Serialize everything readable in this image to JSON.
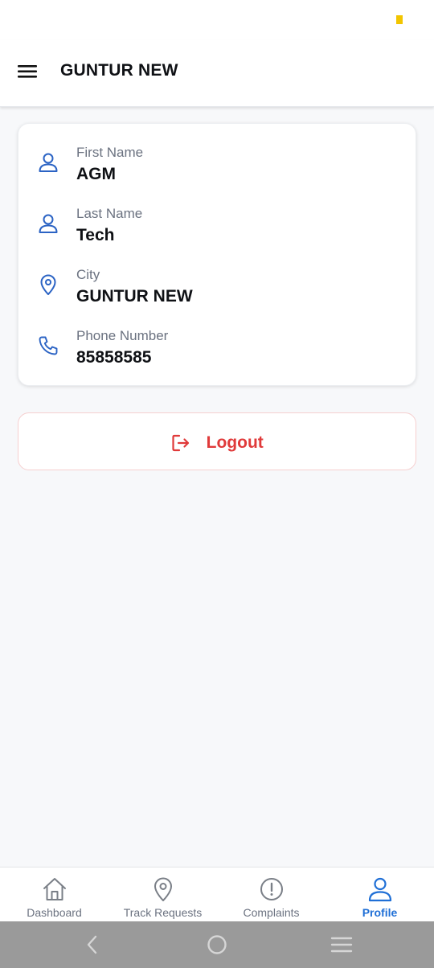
{
  "header": {
    "title": "GUNTUR NEW",
    "menu_icon": "hamburger-menu-icon"
  },
  "profile": {
    "fields": [
      {
        "label": "First Name",
        "value": "AGM",
        "icon": "user-icon"
      },
      {
        "label": "Last Name",
        "value": "Tech",
        "icon": "user-icon"
      },
      {
        "label": "City",
        "value": "GUNTUR NEW",
        "icon": "location-pin-icon"
      },
      {
        "label": "Phone Number",
        "value": "85858585",
        "icon": "phone-icon"
      }
    ]
  },
  "logout": {
    "label": "Logout",
    "icon": "logout-icon",
    "color": "#e03a3a"
  },
  "bottom_nav": {
    "items": [
      {
        "label": "Dashboard",
        "icon": "home-icon",
        "active": false
      },
      {
        "label": "Track Requests",
        "icon": "location-pin-icon",
        "active": false
      },
      {
        "label": "Complaints",
        "icon": "alert-circle-icon",
        "active": false
      },
      {
        "label": "Profile",
        "icon": "user-icon",
        "active": true
      }
    ]
  },
  "colors": {
    "accent": "#1f6fd6",
    "icon_blue": "#2b63c4",
    "danger": "#e03a3a",
    "background": "#f7f8fa"
  },
  "system_nav": {
    "icons": [
      "back-icon",
      "home-circle-icon",
      "recents-icon"
    ]
  }
}
